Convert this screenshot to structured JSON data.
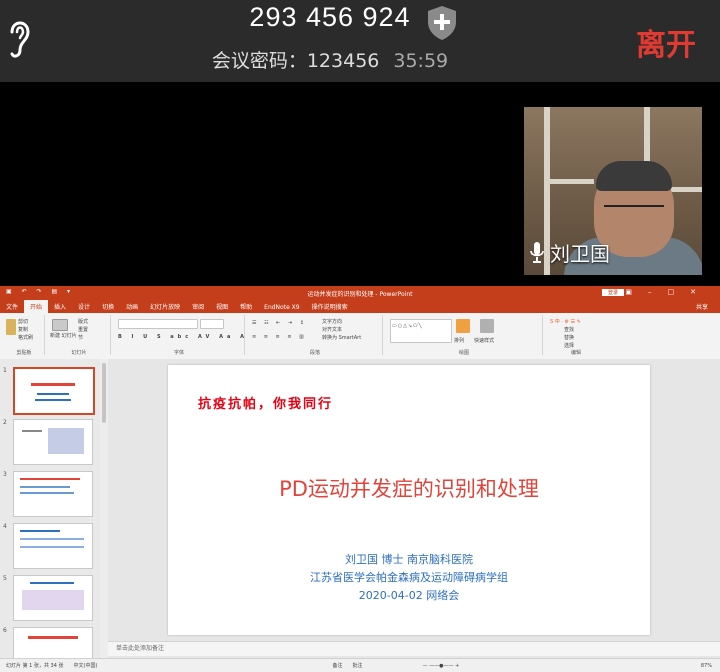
{
  "meeting": {
    "id": "293 456 924",
    "password_label": "会议密码：123456",
    "timer": "35:59",
    "leave_label": "离开"
  },
  "participant": {
    "name": "刘卫国"
  },
  "powerpoint": {
    "window_title": "运动并发症的识别和处理 - PowerPoint",
    "login_label": "登录",
    "tabs": [
      "文件",
      "开始",
      "插入",
      "设计",
      "切换",
      "动画",
      "幻灯片放映",
      "审阅",
      "视图",
      "帮助",
      "EndNote X9",
      "操作说明搜索"
    ],
    "share_label": "共享",
    "ribbon_groups": [
      "剪贴板",
      "幻灯片",
      "字体",
      "段落",
      "绘图",
      "编辑"
    ],
    "ribbon_labels": {
      "cut": "剪切",
      "copy": "复制",
      "format_painter": "格式刷",
      "new_slide": "新建\n幻灯片",
      "layout": "版式",
      "reset": "重置",
      "section": "节",
      "text_direction": "文字方向",
      "align_text": "对齐文本",
      "smartart": "转换为 SmartArt",
      "arrange": "排列",
      "quick_styles": "快速样式",
      "find": "查找",
      "replace": "替换",
      "select": "选择"
    },
    "thumbnail_numbers": [
      "1",
      "2",
      "3",
      "4",
      "5",
      "6"
    ],
    "notes_placeholder": "单击此处添加备注",
    "status_left": "幻灯片 第 1 张，共 34 张　　中文(中国)",
    "status_right": "备注　　批注　　　　　　　　　　　　—  ——●——  +  　　　　　　　　　　　　　　　　　　　　　　　　　　　　　　　　　　　　　　　　　　　　　　　　87%"
  },
  "slide": {
    "slogan": "抗疫抗帕，你我同行",
    "title": "PD运动并发症的识别和处理",
    "lines": [
      "刘卫国 博士 南京脑科医院",
      "江苏省医学会帕金森病及运动障碍病学组",
      "2020-04-02 网络会"
    ]
  },
  "colors": {
    "leave": "#e03a32",
    "ppt_accent": "#c43e1c",
    "slide_title": "#e0443a",
    "slide_blue": "#2e6fbf"
  },
  "icons": {
    "speaker": "ear-icon",
    "shield": "shield-plus-icon",
    "mic": "microphone-icon"
  }
}
